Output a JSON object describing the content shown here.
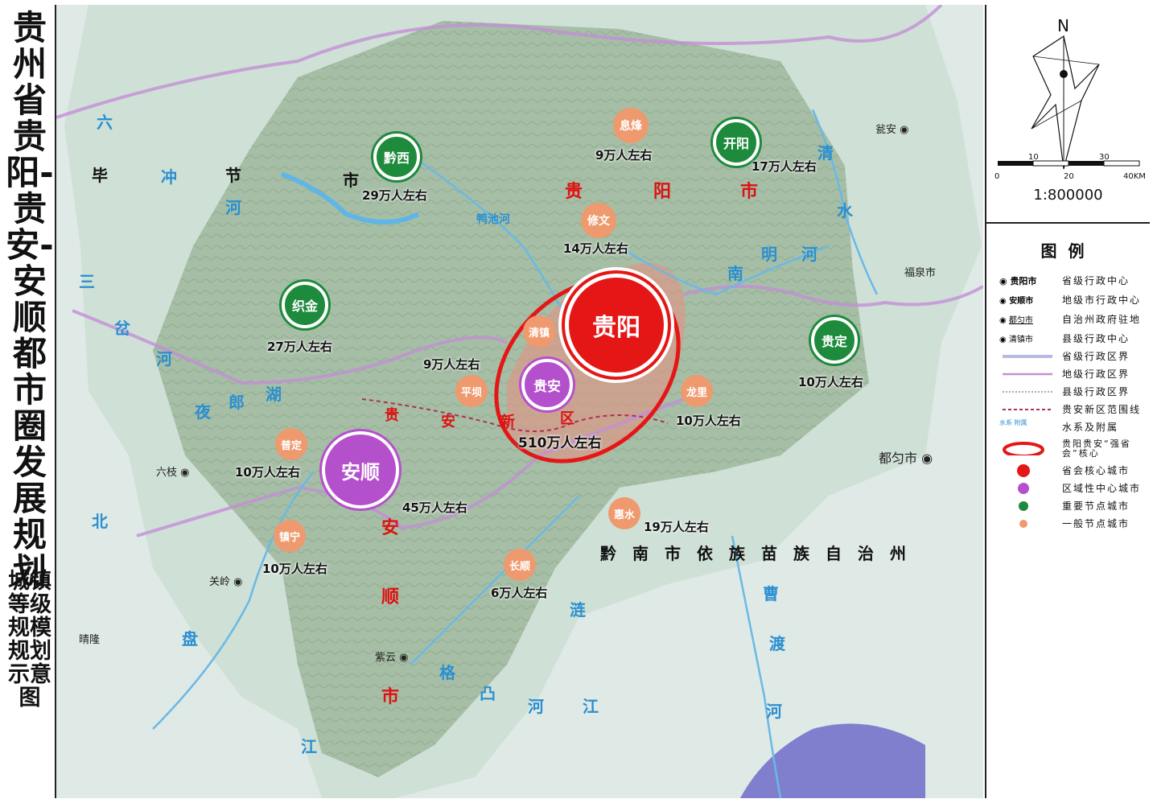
{
  "title": {
    "main": "贵州省贵阳-贵安-安顺都市圈发展规划",
    "sub": "城镇等级规模规划示意图"
  },
  "compass": {
    "north": "N"
  },
  "scale": {
    "ticks": [
      "0",
      "10",
      "20",
      "30",
      "40KM"
    ],
    "ratio": "1:800000"
  },
  "legend": {
    "title": "图例",
    "items": [
      {
        "sym": "贵阳市",
        "label": "省级行政中心"
      },
      {
        "sym": "安顺市",
        "label": "地级市行政中心"
      },
      {
        "sym": "都匀市",
        "label": "自治州政府驻地"
      },
      {
        "sym": "清镇市",
        "label": "县级行政中心"
      },
      {
        "sym": "",
        "label": "省级行政区界"
      },
      {
        "sym": "",
        "label": "地级行政区界"
      },
      {
        "sym": "",
        "label": "县级行政区界"
      },
      {
        "sym": "",
        "label": "贵安新区范围线"
      },
      {
        "sym": "",
        "label": "水系及附属"
      },
      {
        "sym": "贵阳贵安“强省会”核心",
        "label": ""
      },
      {
        "sym": "",
        "label": "省会核心城市"
      },
      {
        "sym": "",
        "label": "区域性中心城市"
      },
      {
        "sym": "",
        "label": "重要节点城市"
      },
      {
        "sym": "",
        "label": "一般节点城市"
      }
    ],
    "water_sym": "水系 附属",
    "colors": {
      "provincial_border": "#b8b8e6",
      "prefecture_border": "#c38fd6",
      "county_border": "#555555",
      "guian_new_area": "#b03050",
      "core_ring": "#e51616",
      "core_city": "#e51616",
      "regional_center": "#b550cc",
      "important_node": "#1e8a3c",
      "general_node": "#ee9a6e"
    }
  },
  "nodes": {
    "guiyang": {
      "name": "贵阳",
      "pop": "510万人左右"
    },
    "anshun": {
      "name": "安顺",
      "pop": "45万人左右"
    },
    "guian": {
      "name": "贵安"
    },
    "qianxi": {
      "name": "黔西",
      "pop": "29万人左右"
    },
    "zhijin": {
      "name": "织金",
      "pop": "27万人左右"
    },
    "kaiyang": {
      "name": "开阳",
      "pop": "17万人左右"
    },
    "guiding": {
      "name": "贵定",
      "pop": "10万人左右"
    },
    "xifeng": {
      "name": "息烽",
      "pop": "9万人左右"
    },
    "xiuwen": {
      "name": "修文",
      "pop": "14万人左右"
    },
    "qingzhen": {
      "name": "清镇",
      "pop": "9万人左右"
    },
    "pingba": {
      "name": "平坝"
    },
    "longli": {
      "name": "龙里",
      "pop": "10万人左右"
    },
    "puding": {
      "name": "普定",
      "pop": "10万人左右"
    },
    "zhenning": {
      "name": "镇宁",
      "pop": "10万人左右"
    },
    "changshun": {
      "name": "长顺",
      "pop": "6万人左右"
    },
    "huishui": {
      "name": "惠水",
      "pop": "19万人左右"
    }
  },
  "places": {
    "wengan": "瓮安",
    "fuquan": "福泉市",
    "duyun": "都匀市",
    "liuzhi": "六枝",
    "guanling": "关岭",
    "qinglong": "晴隆",
    "ziyun": "紫云"
  },
  "regions": {
    "bijie": [
      "毕",
      "节",
      "市"
    ],
    "guiyang_city": [
      "贵",
      "阳",
      "市"
    ],
    "guian_new": [
      "贵",
      "安",
      "新",
      "区"
    ],
    "anshun_city": [
      "安",
      "顺",
      "市"
    ],
    "qiannan": "黔南市依族苗族自治州"
  },
  "rivers": {
    "liuchong": [
      "六",
      "冲",
      "河"
    ],
    "sancha": [
      "三",
      "岔",
      "河"
    ],
    "yelang": [
      "夜",
      "郎",
      "湖"
    ],
    "yachi": "鸭池河",
    "nanming": [
      "南",
      "明",
      "河"
    ],
    "qingshui": [
      "清",
      "水"
    ],
    "beipan": [
      "北",
      "盘",
      "江"
    ],
    "getu": [
      "格",
      "凸",
      "河"
    ],
    "lian": [
      "涟",
      "江"
    ],
    "caodu": [
      "曹",
      "渡",
      "河"
    ]
  }
}
